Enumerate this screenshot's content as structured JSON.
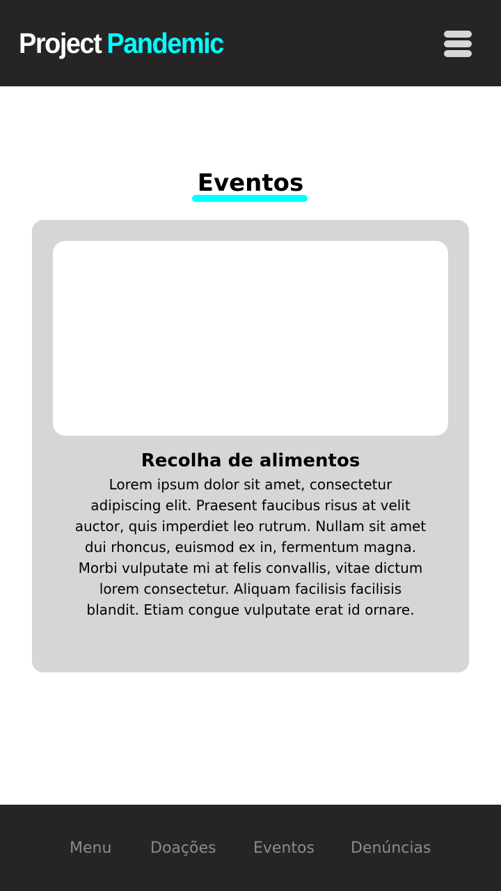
{
  "header": {
    "logo_word1": "Project",
    "logo_word2": "Pandemic",
    "menu_icon": "hamburger-menu-icon"
  },
  "main": {
    "section_title": "Eventos"
  },
  "event_card": {
    "title": "Recolha de alimentos",
    "description": "Lorem ipsum dolor sit amet, consectetur adipiscing elit. Praesent faucibus risus at velit auctor, quis imperdiet leo rutrum. Nullam sit amet dui rhoncus, euismod ex in, fermentum magna. Morbi vulputate mi at felis convallis, vitae dictum lorem consectetur. Aliquam facilisis facilisis blandit. Etiam congue vulputate erat id ornare."
  },
  "footer_nav": {
    "items": [
      {
        "label": "Menu"
      },
      {
        "label": "Doações"
      },
      {
        "label": "Eventos"
      },
      {
        "label": "Denúncias"
      }
    ]
  },
  "colors": {
    "bar_background": "#262425",
    "accent": "#00ffff",
    "card_background": "#d6d6d6",
    "nav_text": "#8c8c8c"
  }
}
